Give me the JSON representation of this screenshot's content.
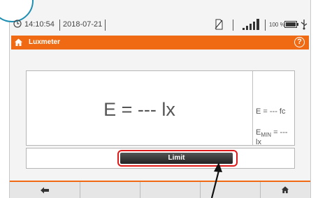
{
  "status": {
    "time": "14:10:54",
    "date": "2018-07-21",
    "battery_percent": "100 %"
  },
  "titlebar": {
    "title": "Luxmeter",
    "help": "?"
  },
  "measurement": {
    "main": "E = --- lx",
    "fc": "E = --- fc",
    "emin_prefix": "E",
    "emin_sub": "MIN",
    "emin_rest": " = --- lx"
  },
  "limit": {
    "label": "Limit"
  },
  "colors": {
    "accent": "#ef6a12",
    "highlight": "#e01818",
    "callout": "#1e8fb3"
  },
  "icons": {
    "clock": "clock-icon",
    "no-sd": "no-sd-icon",
    "signal": "signal-icon",
    "battery": "battery-icon",
    "usb": "usb-icon",
    "home": "home-icon",
    "back": "back-arrow-icon"
  }
}
